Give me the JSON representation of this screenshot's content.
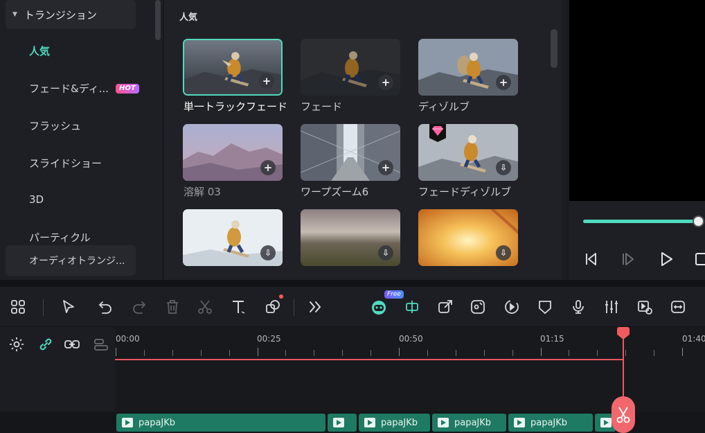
{
  "sidebar": {
    "header": "トランジション",
    "items": [
      {
        "label": "人気",
        "active": true
      },
      {
        "label": "フェード&ディ...",
        "badge": "HOT"
      },
      {
        "label": "フラッシュ"
      },
      {
        "label": "スライドショー"
      },
      {
        "label": "3D"
      },
      {
        "label": "パーティクル"
      },
      {
        "label": "オーディオトランジ..."
      }
    ]
  },
  "gallery": {
    "title": "人気",
    "tiles": [
      {
        "label": "単一トラックフェード",
        "action": "add",
        "selected": true,
        "thumb": "snowboarder"
      },
      {
        "label": "フェード",
        "action": "add",
        "thumb": "snowboarder-dark"
      },
      {
        "label": "ディゾルブ",
        "action": "add",
        "thumb": "snowboarder-double"
      },
      {
        "label": "溶解 03",
        "action": "add",
        "thumb": "mountains"
      },
      {
        "label": "ワープズーム6",
        "action": "add",
        "thumb": "city-street"
      },
      {
        "label": "フェードディゾルブ",
        "action": "download",
        "premium": true,
        "thumb": "snowboarder-fade"
      },
      {
        "label": "",
        "action": "download",
        "thumb": "snowboarder-bright"
      },
      {
        "label": "",
        "action": "download",
        "thumb": "motion-blur"
      },
      {
        "label": "",
        "action": "download",
        "thumb": "light-leak"
      }
    ]
  },
  "preview": {
    "progress": 1.0
  },
  "toolbar": {
    "free_badge": "Free",
    "icons": [
      "grid-icon",
      "select-arrow-icon",
      "undo-icon",
      "redo-icon",
      "delete-icon",
      "cut-icon",
      "text-icon",
      "shape-icon",
      "more-icon",
      "ai-robot-icon",
      "split-icon",
      "export-icon",
      "sticker-icon",
      "speed-icon",
      "mask-icon",
      "mic-icon",
      "audio-mixer-icon",
      "replace-icon",
      "fit-icon"
    ]
  },
  "timeline": {
    "ruler": [
      "00:00",
      "00:25",
      "00:50",
      "01:15",
      "01:40"
    ],
    "clips": [
      {
        "label": "papaJKb"
      },
      {
        "label": ""
      },
      {
        "label": "papaJKb"
      },
      {
        "label": "papaJKb"
      },
      {
        "label": "papaJKb"
      },
      {
        "label": ""
      }
    ]
  },
  "colors": {
    "accent": "#4fdcbf",
    "playhead": "#f05a5f",
    "clip": "#1f7a63"
  }
}
